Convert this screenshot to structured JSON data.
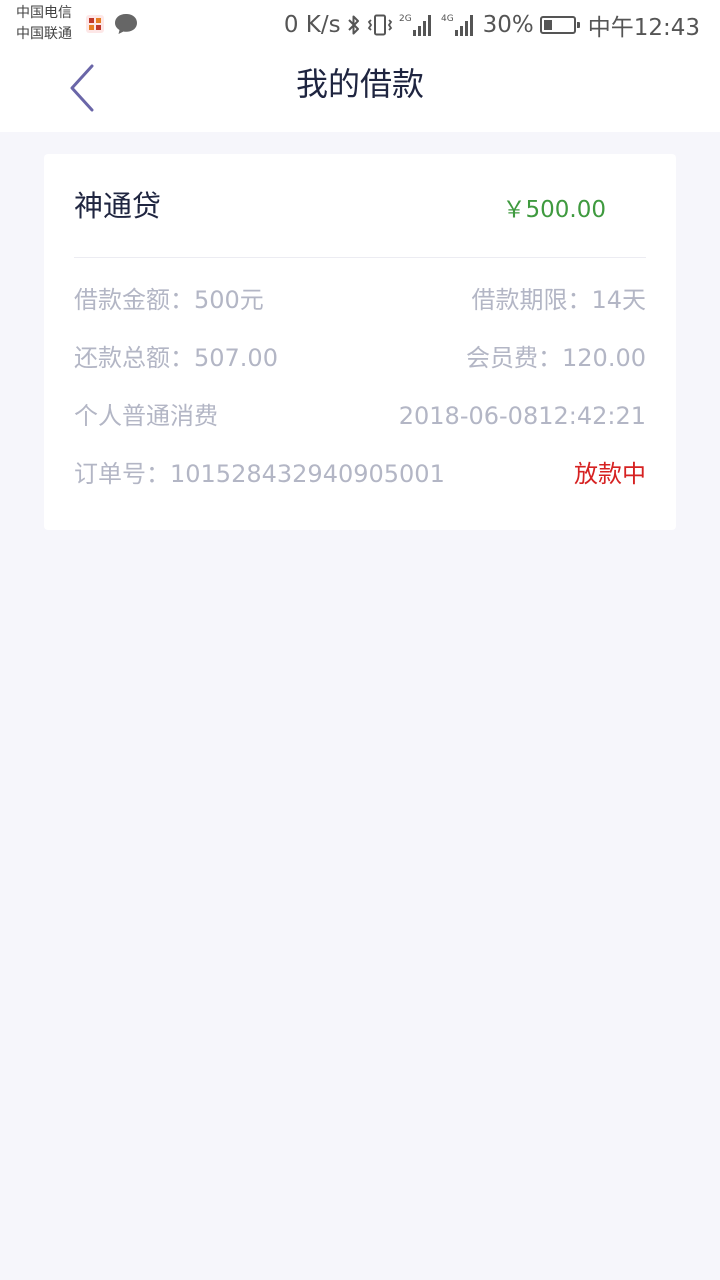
{
  "status_bar": {
    "carrier_1": "中国电信",
    "carrier_2": "中国联通",
    "net_speed": "0 K/s",
    "signal_2g_label": "2G",
    "signal_4g_label": "4G",
    "battery_percent_text": "30%",
    "battery_level": 0.3,
    "time": "中午12:43",
    "icons": [
      "app-icon",
      "chat-bubble-icon",
      "bluetooth-icon",
      "vibrate-icon",
      "signal-2g-icon",
      "signal-4g-icon",
      "battery-icon"
    ]
  },
  "header": {
    "title": "我的借款",
    "back_icon": "chevron-left-icon"
  },
  "loan": {
    "name": "神通贷",
    "amount": "￥500.00",
    "loan_amount_text": "借款金额：500元",
    "loan_term_text": "借款期限：14天",
    "repay_total_text": "还款总额：507.00",
    "member_fee_text": "会员费：120.00",
    "category": "个人普通消费",
    "datetime": "2018-06-0812:42:21",
    "order_no_text": "订单号：101528432940905001",
    "status": "放款中"
  },
  "colors": {
    "background": "#f6f6fb",
    "title": "#1f2540",
    "amount_green": "#3f9a3f",
    "status_red": "#d62222",
    "muted_text": "#b3b6c5",
    "back_chevron": "#6a66a8"
  }
}
